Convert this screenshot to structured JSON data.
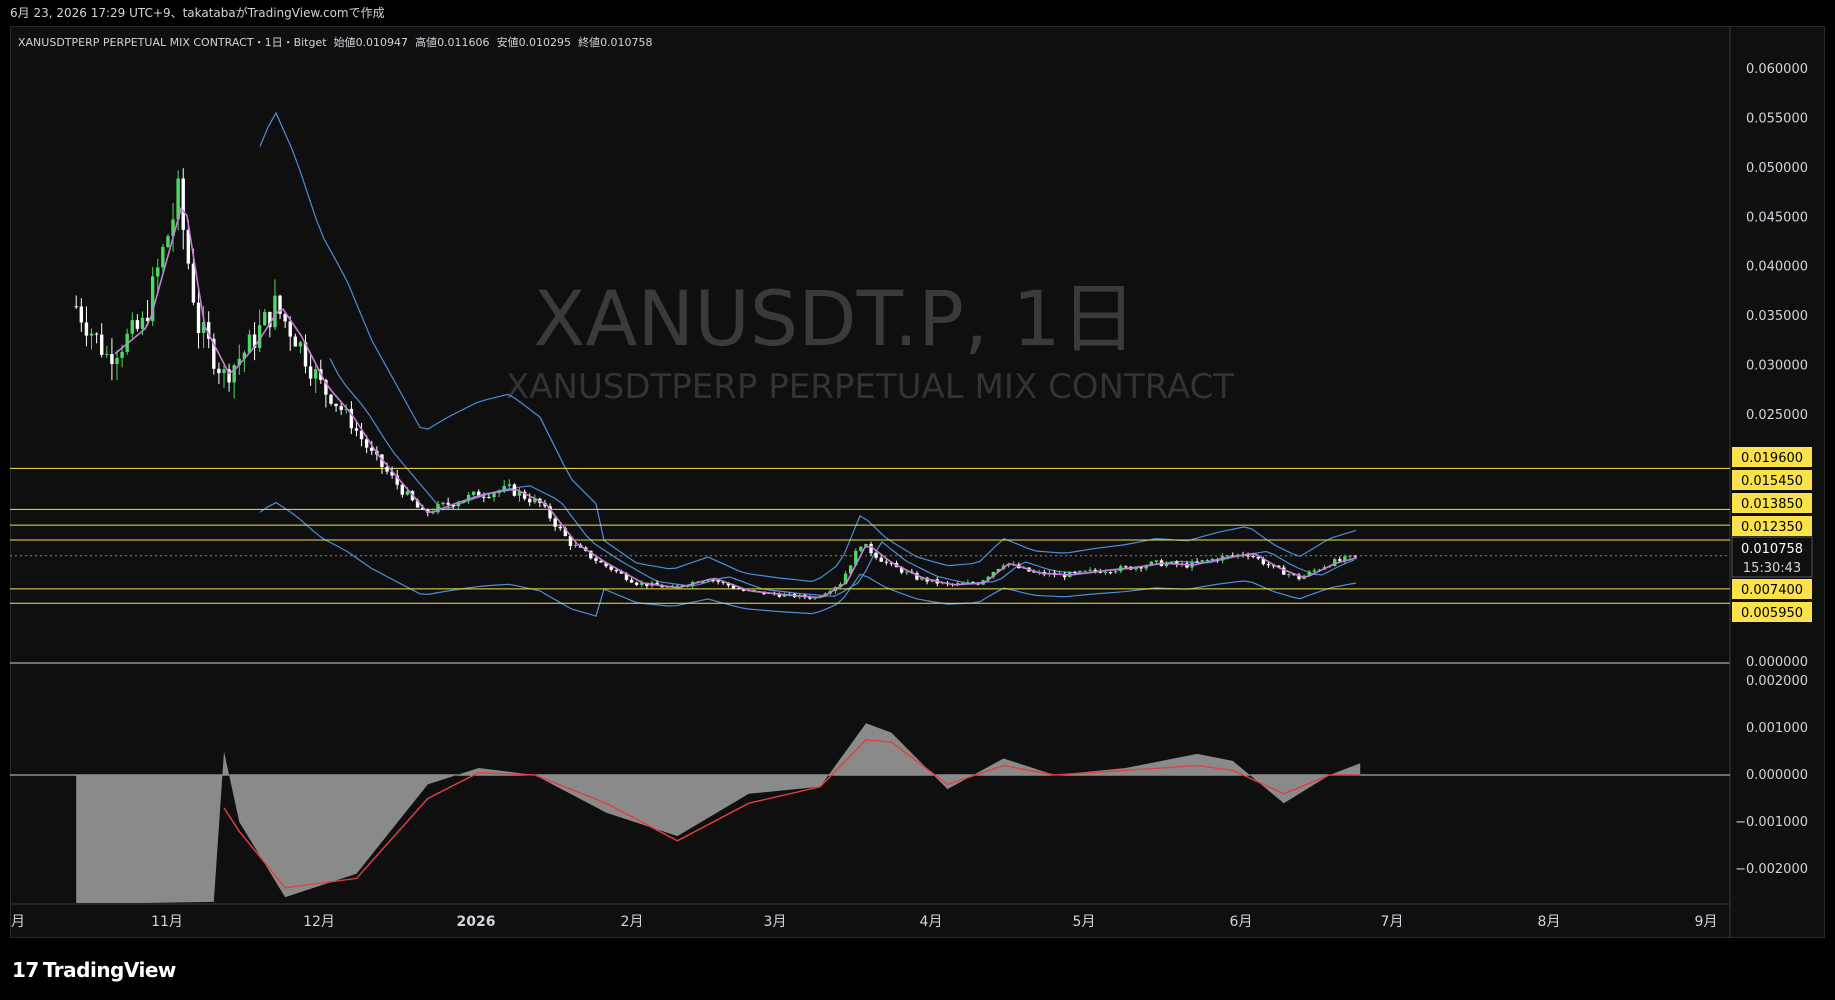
{
  "header": {
    "info_text": "6月 23, 2026 17:29 UTC+9、takatabaがTradingView.comで作成"
  },
  "legend": {
    "symbol_text": "XANUSDTPERP PERPETUAL MIX CONTRACT・1日・Bitget",
    "open_label": "始値",
    "open_value": "0.010947",
    "high_label": "高値",
    "high_value": "0.011606",
    "low_label": "安値",
    "low_value": "0.010295",
    "close_label": "終値",
    "close_value": "0.010758"
  },
  "watermark": {
    "main": "XANUSDT.P, 1日",
    "sub": "XANUSDTPERP PERPETUAL MIX CONTRACT"
  },
  "branding": {
    "logo_mark": "17",
    "logo_text": "TradingView"
  },
  "colors": {
    "background": "#0f0f0f",
    "up_candle": "#4cd964",
    "down_candle": "#ffffff",
    "ma_line": "#c77dd6",
    "bollinger": "#4a8fd6",
    "level_line": "#f2e04a",
    "macd_hist": "#8a8a8a",
    "signal_line": "#e0413e",
    "price_label_bg": "#fbe14a"
  },
  "chart_data": [
    {
      "type": "line",
      "panel": "price",
      "price_axis_ticks": [
        "0.060000",
        "0.055000",
        "0.050000",
        "0.045000",
        "0.040000",
        "0.035000",
        "0.030000",
        "0.025000",
        "0.000000"
      ],
      "ylim": [
        0.0,
        0.0625
      ],
      "x_axis_labels": [
        "月",
        "11月",
        "12月",
        "2026",
        "2月",
        "3月",
        "4月",
        "5月",
        "6月",
        "7月",
        "8月",
        "9月"
      ],
      "horizontal_levels": [
        0.0196,
        0.01545,
        0.01385,
        0.01235,
        0.0074,
        0.00595
      ],
      "level_labels": [
        "0.019600",
        "0.015450",
        "0.013850",
        "0.012350",
        "0.007400",
        "0.005950"
      ],
      "last_price": "0.010758",
      "countdown": "15:30:43",
      "close_series": {
        "x": [
          "2025-10-14",
          "2025-10-20",
          "2025-10-27",
          "2025-11-03",
          "2025-11-07",
          "2025-11-12",
          "2025-11-17",
          "2025-11-22",
          "2025-11-26",
          "2025-12-01",
          "2025-12-06",
          "2025-12-11",
          "2025-12-16",
          "2025-12-21",
          "2025-12-26",
          "2026-01-01",
          "2026-01-07",
          "2026-01-13",
          "2026-01-19",
          "2026-01-25",
          "2026-02-01",
          "2026-02-08",
          "2026-02-15",
          "2026-02-22",
          "2026-03-01",
          "2026-03-08",
          "2026-03-13",
          "2026-03-17",
          "2026-03-22",
          "2026-03-28",
          "2026-04-03",
          "2026-04-09",
          "2026-04-14",
          "2026-04-20",
          "2026-04-26",
          "2026-05-02",
          "2026-05-08",
          "2026-05-14",
          "2026-05-20",
          "2026-05-26",
          "2026-06-01",
          "2026-06-06",
          "2026-06-11",
          "2026-06-17",
          "2026-06-23"
        ],
        "y": [
          0.036,
          0.031,
          0.034,
          0.047,
          0.034,
          0.029,
          0.032,
          0.036,
          0.033,
          0.028,
          0.025,
          0.021,
          0.018,
          0.015,
          0.016,
          0.017,
          0.0175,
          0.016,
          0.012,
          0.01,
          0.008,
          0.0075,
          0.0085,
          0.0072,
          0.0068,
          0.0065,
          0.008,
          0.012,
          0.01,
          0.0085,
          0.0078,
          0.008,
          0.01,
          0.009,
          0.0088,
          0.0092,
          0.0095,
          0.01,
          0.0098,
          0.0105,
          0.011,
          0.0095,
          0.0085,
          0.01,
          0.010758
        ]
      }
    },
    {
      "type": "area",
      "panel": "macd",
      "price_axis_ticks": [
        "0.002000",
        "0.001000",
        "0.000000",
        "−0.001000",
        "−0.002000"
      ],
      "ylim": [
        -0.00275,
        0.0022
      ],
      "x": [
        "2025-10-14",
        "2025-10-27",
        "2025-11-10",
        "2025-11-12",
        "2025-11-15",
        "2025-11-24",
        "2025-12-08",
        "2025-12-22",
        "2026-01-01",
        "2026-01-12",
        "2026-01-26",
        "2026-02-09",
        "2026-02-23",
        "2026-03-09",
        "2026-03-18",
        "2026-03-23",
        "2026-04-03",
        "2026-04-14",
        "2026-04-24",
        "2026-05-08",
        "2026-05-22",
        "2026-05-29",
        "2026-06-08",
        "2026-06-17",
        "2026-06-23"
      ],
      "histogram": [
        -0.00275,
        -0.00275,
        -0.0027,
        0.0005,
        -0.001,
        -0.0026,
        -0.0021,
        -0.0002,
        0.00015,
        0.0,
        -0.0008,
        -0.0013,
        -0.0004,
        -0.00025,
        0.0011,
        0.0009,
        -0.0003,
        0.00035,
        0.0,
        0.00015,
        0.00045,
        0.0003,
        -0.0006,
        0.0,
        0.00025
      ],
      "signal": [
        null,
        null,
        null,
        -0.0007,
        -0.0012,
        -0.0024,
        -0.0022,
        -0.0005,
        5e-05,
        0.0,
        -0.0006,
        -0.0014,
        -0.0006,
        -0.00025,
        0.00075,
        0.0007,
        -0.0002,
        0.0002,
        0.0,
        0.0001,
        0.0002,
        0.0001,
        -0.0004,
        0.0,
        0.0
      ]
    }
  ]
}
